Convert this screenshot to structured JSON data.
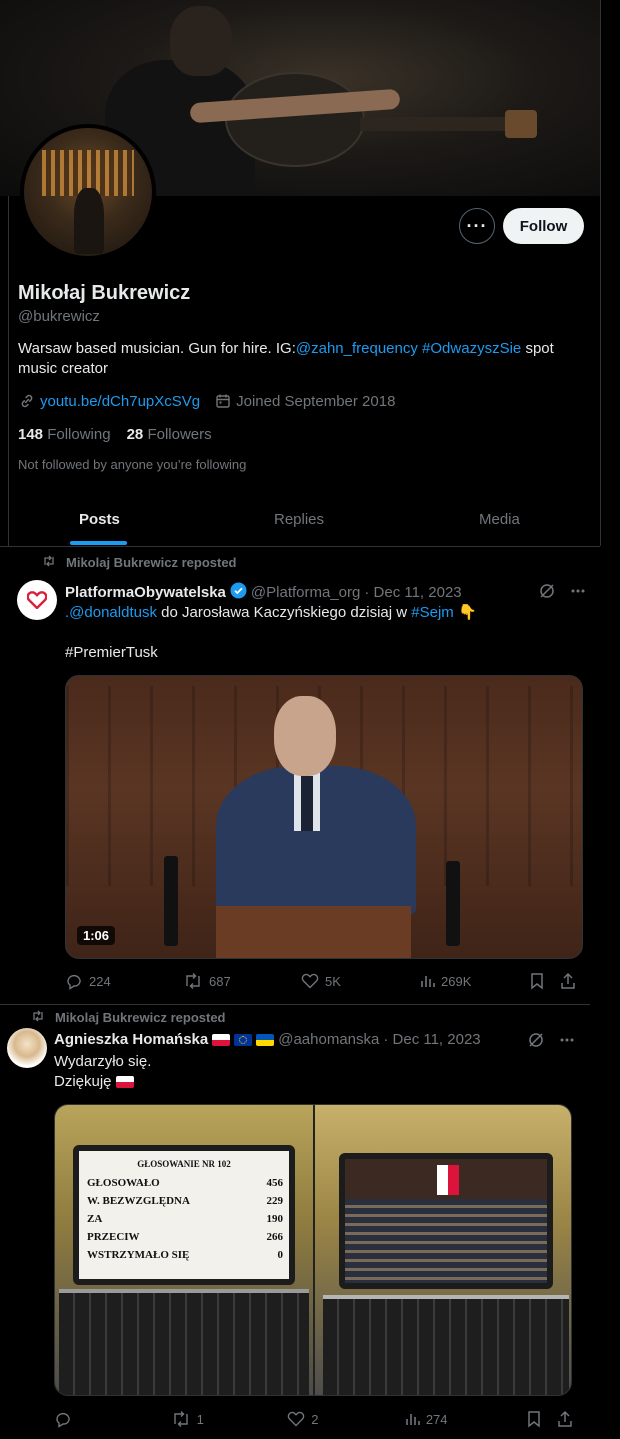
{
  "profile": {
    "name": "Mikołaj Bukrewicz",
    "handle": "@bukrewicz",
    "bio_text": "Warsaw based musician. Gun for hire. IG:",
    "bio_link_ig": "@zahn_frequency",
    "bio_hashtag": "#OdwazyszSie",
    "bio_tail": "spot",
    "bio_line2": "music creator",
    "website": "youtu.be/dCh7upXcSVg",
    "joined": "Joined September 2018",
    "following_count": "148",
    "following_label": "Following",
    "followers_count": "28",
    "followers_label": "Followers",
    "not_followed": "Not followed by anyone you’re following",
    "more_label": "···",
    "follow_label": "Follow"
  },
  "tabs": [
    "Posts",
    "Replies",
    "Media"
  ],
  "tweets": [
    {
      "repost_label": "Mikolaj Bukrewicz reposted",
      "author": "PlatformaObywatelska",
      "verified": true,
      "handle": "@Platforma_org",
      "date": "· Dec 11, 2023",
      "text_mention": ".@donaldtusk",
      "text_body": "do Jarosława Kaczyńskiego dzisiaj w",
      "text_hashtag": "#Sejm",
      "text_emoji": "👇",
      "hashtag2": "#PremierTusk",
      "video_duration": "1:06",
      "replies": "224",
      "reposts": "687",
      "likes": "5K",
      "views": "269K"
    },
    {
      "repost_label": "Mikolaj Bukrewicz reposted",
      "author": "Agnieszka Homańska",
      "handle": "@aahomanska",
      "date": "· Dec 11, 2023",
      "line1": "Wydarzyło się.",
      "line2": "Dziękuję",
      "replies": "",
      "reposts": "1",
      "likes": "2",
      "views": "274",
      "vote_title": "GŁOSOWANIE NR 102",
      "vote_rows": [
        {
          "label": "GŁOSOWAŁO",
          "value": "456"
        },
        {
          "label": "W. BEZWZGLĘDNA",
          "value": "229"
        },
        {
          "label": "ZA",
          "value": "190"
        },
        {
          "label": "PRZECIW",
          "value": "266"
        },
        {
          "label": "WSTRZYMAŁO SIĘ",
          "value": "0"
        }
      ]
    }
  ],
  "colors": {
    "background": "#000000",
    "text": "#e7e9ea",
    "muted": "#71767b",
    "link": "#1d9bf0",
    "follow_bg": "#eff3f4"
  }
}
